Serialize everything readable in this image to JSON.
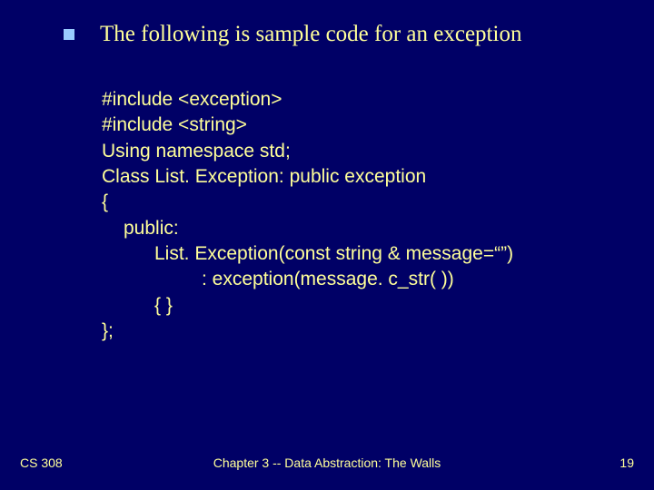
{
  "bullet_text": "The following is sample code for an exception",
  "code": {
    "l1": "#include <exception>",
    "l2": "#include <string>",
    "l3": "Using namespace std;",
    "l4": "Class List. Exception: public exception",
    "l5": "{",
    "l6": "public:",
    "l7": "List. Exception(const string & message=“”)",
    "l8": ": exception(message. c_str( ))",
    "l9": "{ }",
    "l10": "};"
  },
  "footer": {
    "left": "CS 308",
    "center": "Chapter 3 -- Data Abstraction: The Walls",
    "right": "19"
  }
}
